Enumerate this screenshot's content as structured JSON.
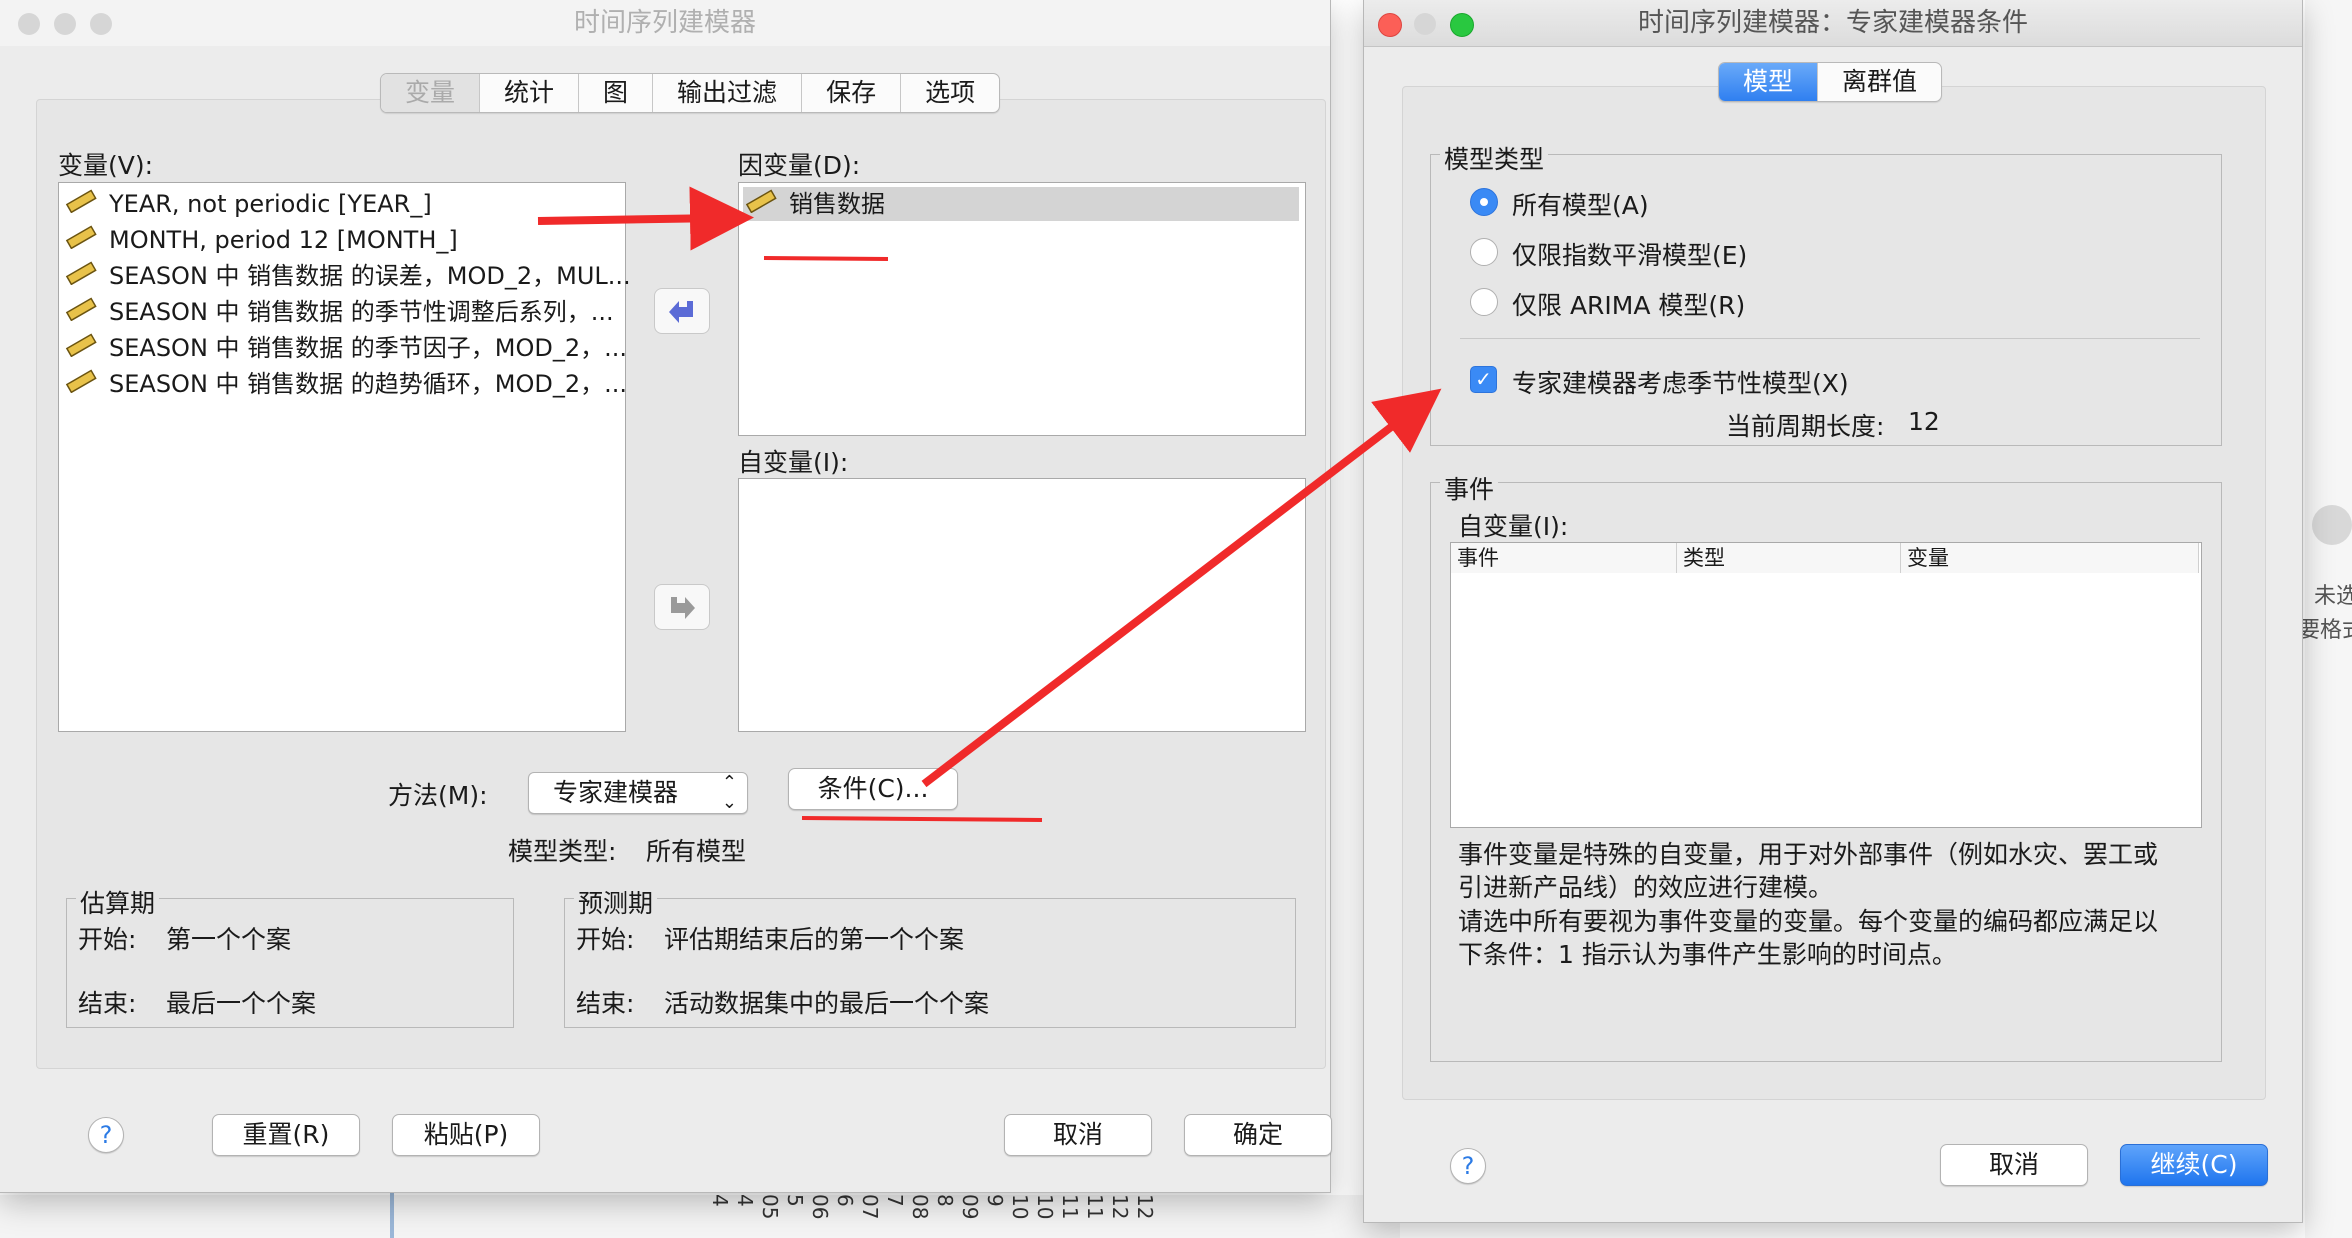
{
  "main_window": {
    "title": "时间序列建模器",
    "tabs": [
      {
        "label": "变量",
        "selected": true
      },
      {
        "label": "统计",
        "selected": false
      },
      {
        "label": "图",
        "selected": false
      },
      {
        "label": "输出过滤",
        "selected": false
      },
      {
        "label": "保存",
        "selected": false
      },
      {
        "label": "选项",
        "selected": false
      }
    ],
    "variables_label": "变量(V):",
    "variables": [
      "YEAR, not periodic [YEAR_]",
      "MONTH, period 12 [MONTH_]",
      "SEASON 中 销售数据 的误差，MOD_2，MUL...",
      "SEASON 中 销售数据 的季节性调整后系列，...",
      "SEASON 中 销售数据 的季节因子，MOD_2，...",
      "SEASON 中 销售数据 的趋势循环，MOD_2，..."
    ],
    "dependent_label": "因变量(D):",
    "dependent_items": [
      "销售数据"
    ],
    "independent_label": "自变量(I):",
    "method_label": "方法(M):",
    "method_value": "专家建模器",
    "criteria_button": "条件(C)...",
    "model_type_label": "模型类型:",
    "model_type_value": "所有模型",
    "estimation": {
      "title": "估算期",
      "start_label": "开始:",
      "start_value": "第一个个案",
      "end_label": "结束:",
      "end_value": "最后一个个案"
    },
    "forecast": {
      "title": "预测期",
      "start_label": "开始:",
      "start_value": "评估期结束后的第一个个案",
      "end_label": "结束:",
      "end_value": "活动数据集中的最后一个个案"
    },
    "buttons": {
      "help": "?",
      "reset": "重置(R)",
      "paste": "粘贴(P)",
      "cancel": "取消",
      "ok": "确定"
    }
  },
  "criteria_window": {
    "title": "时间序列建模器：专家建模器条件",
    "tabs": [
      {
        "label": "模型",
        "selected": true
      },
      {
        "label": "离群值",
        "selected": false
      }
    ],
    "model_type_group": "模型类型",
    "radios": [
      {
        "label": "所有模型(A)",
        "selected": true
      },
      {
        "label": "仅限指数平滑模型(E)",
        "selected": false
      },
      {
        "label": "仅限 ARIMA 模型(R)",
        "selected": false
      }
    ],
    "seasonal_checkbox": {
      "label": "专家建模器考虑季节性模型(X)",
      "checked": true
    },
    "current_period_label": "当前周期长度:",
    "current_period_value": "12",
    "events_group": "事件",
    "independent_label": "自变量(I):",
    "table_headers": [
      "事件",
      "类型",
      "变量"
    ],
    "description_lines": [
      "事件变量是特殊的自变量，用于对外部事件（例如水灾、罢工或",
      "引进新产品线）的效应进行建模。",
      "请选中所有要视为事件变量的变量。每个变量的编码都应满足以",
      "下条件：1 指示认为事件产生影响的时间点。"
    ],
    "buttons": {
      "help": "?",
      "cancel": "取消",
      "continue": "继续(C)"
    }
  },
  "background": {
    "right_edge_text": [
      "未选",
      "要格式"
    ],
    "bottom_ticks": [
      "4",
      "4",
      "05",
      "5",
      "06",
      "6",
      "07",
      "7",
      "08",
      "8",
      "09",
      "9",
      "10",
      "10",
      "11",
      "11",
      "12",
      "12"
    ]
  },
  "colors": {
    "annotation_red": "#f02a2a",
    "accent_blue": "#2f7ff0"
  }
}
